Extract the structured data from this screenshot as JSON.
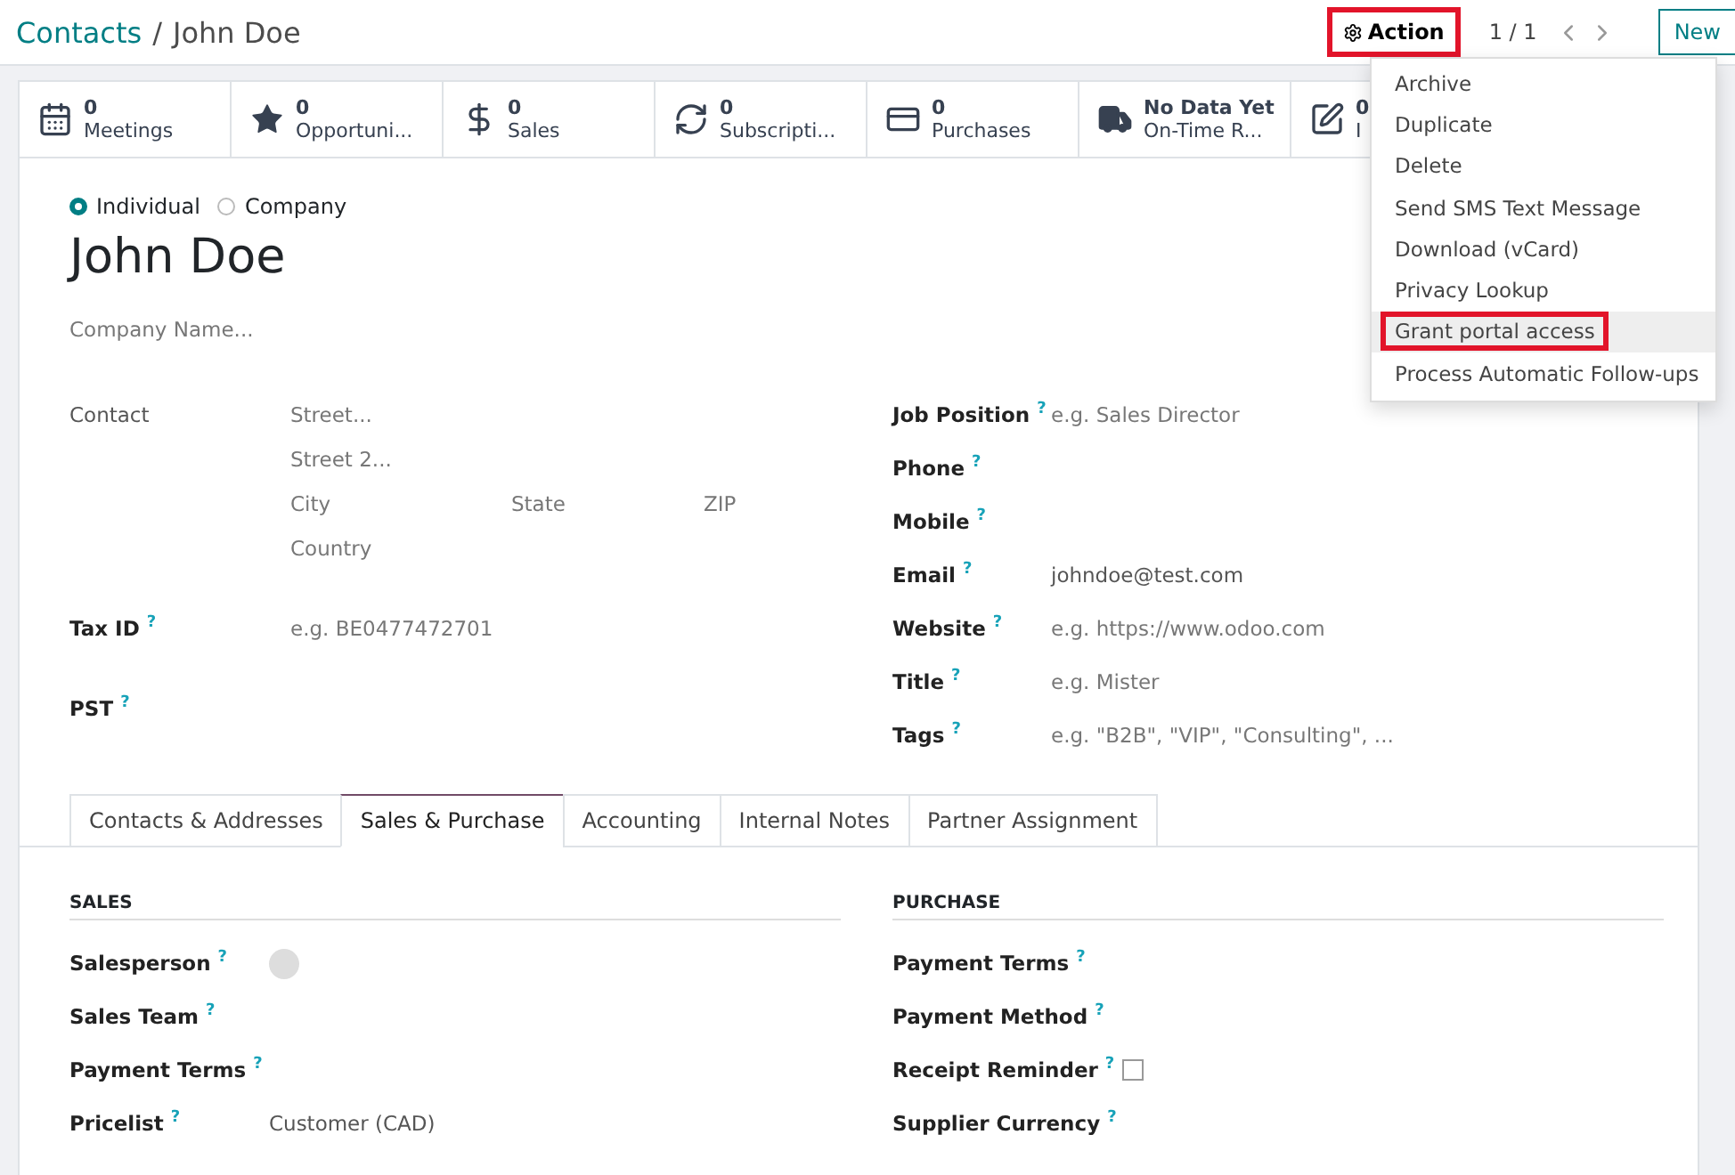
{
  "breadcrumb": {
    "parent": "Contacts",
    "separator": "/",
    "current": "John Doe"
  },
  "action_button": {
    "label": "Action",
    "highlighted": true
  },
  "pager": "1 / 1",
  "new_button": "New",
  "action_menu": [
    {
      "label": "Archive",
      "selected": false,
      "highlighted": false
    },
    {
      "label": "Duplicate",
      "selected": false,
      "highlighted": false
    },
    {
      "label": "Delete",
      "selected": false,
      "highlighted": false
    },
    {
      "label": "Send SMS Text Message",
      "selected": false,
      "highlighted": false
    },
    {
      "label": "Download (vCard)",
      "selected": false,
      "highlighted": false
    },
    {
      "label": "Privacy Lookup",
      "selected": false,
      "highlighted": false
    },
    {
      "label": "Grant portal access",
      "selected": true,
      "highlighted": true
    },
    {
      "label": "Process Automatic Follow-ups",
      "selected": false,
      "highlighted": false
    }
  ],
  "smart_buttons": [
    {
      "kind": "calendar",
      "value": "0",
      "label": "Meetings"
    },
    {
      "kind": "star",
      "value": "0",
      "label": "Opportuni..."
    },
    {
      "kind": "dollar",
      "value": "0",
      "label": "Sales"
    },
    {
      "kind": "refresh",
      "value": "0",
      "label": "Subscripti..."
    },
    {
      "kind": "card",
      "value": "0",
      "label": "Purchases"
    },
    {
      "kind": "truck",
      "value": "No Data Yet",
      "label": "On-Time R..."
    },
    {
      "kind": "edit",
      "value": "0",
      "label": "I"
    }
  ],
  "partner_type": [
    {
      "label": "Individual",
      "selected": true
    },
    {
      "label": "Company",
      "selected": false
    }
  ],
  "name": "John Doe",
  "company_placeholder": "Company Name...",
  "address": {
    "label": "Contact",
    "street": "Street...",
    "street2": "Street 2...",
    "city": "City",
    "state": "State",
    "zip": "ZIP",
    "country": "Country"
  },
  "left_fields": [
    {
      "label": "Tax ID $^{?}$",
      "placeholder": "e.g. BE0477472701"
    },
    {
      "label": "PST $^{?}$"
    }
  ],
  "right_fields": [
    {
      "label": "Job Position $^{?}$",
      "placeholder": "e.g. Sales Director"
    },
    {
      "label": "Phone $^{?}$"
    },
    {
      "label": "Mobile $^{?}$"
    },
    {
      "label": "Email $^{?}$",
      "value": "johndoe@test.com"
    },
    {
      "label": "Website $^{?}$",
      "placeholder": "e.g. https://www.odoo.com"
    },
    {
      "label": "Title $^{?}$",
      "placeholder": "e.g. Mister"
    },
    {
      "label": "Tags $^{?}$",
      "placeholder": "e.g. \"B2B\", \"VIP\", \"Consulting\", ..."
    }
  ],
  "tabs": [
    {
      "label": "Contacts & Addresses",
      "selected": false
    },
    {
      "label": "Sales & Purchase",
      "selected": true
    },
    {
      "label": "Accounting",
      "selected": false
    },
    {
      "label": "Internal Notes",
      "selected": false
    },
    {
      "label": "Partner Assignment",
      "selected": false
    }
  ],
  "sales": {
    "title": "SALES",
    "fields": [
      {
        "kind": "avatar",
        "label": "Salesperson $^{?}$"
      },
      {
        "kind": "text",
        "label": "Sales Team $^{?}$"
      },
      {
        "kind": "text",
        "label": "Payment Terms $^{?}$"
      },
      {
        "kind": "text",
        "label": "Pricelist $^{?}$",
        "value": "Customer (CAD)"
      }
    ]
  },
  "purchase": {
    "title": "PURCHASE",
    "fields": [
      {
        "kind": "text",
        "label": "Payment Terms $^{?}$"
      },
      {
        "kind": "text",
        "label": "Payment Method $^{?}$"
      },
      {
        "kind": "checkbox",
        "label": "Receipt Reminder $^{?}$",
        "checked": false
      },
      {
        "kind": "text",
        "label": "Supplier Currency $^{?}$"
      }
    ]
  }
}
